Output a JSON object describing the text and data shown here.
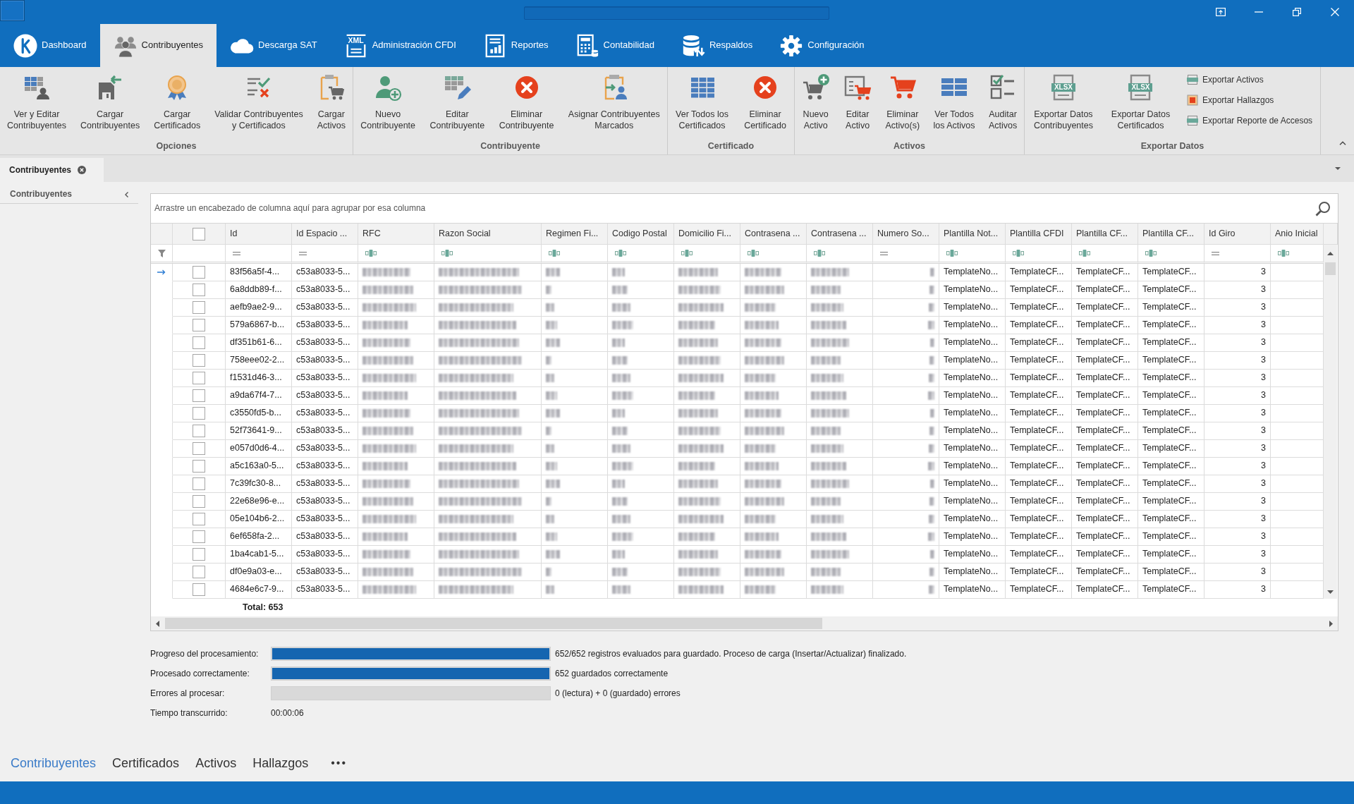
{
  "tabs": [
    {
      "label": "Dashboard",
      "selected": false
    },
    {
      "label": "Contribuyentes",
      "selected": true
    },
    {
      "label": "Descarga SAT",
      "selected": false
    },
    {
      "label": "Administración CFDI",
      "selected": false,
      "icon_text": "XML"
    },
    {
      "label": "Reportes",
      "selected": false
    },
    {
      "label": "Contabilidad",
      "selected": false
    },
    {
      "label": "Respaldos",
      "selected": false
    },
    {
      "label": "Configuración",
      "selected": false
    }
  ],
  "ribbon": {
    "groups": [
      {
        "title": "Opciones",
        "buttons": [
          {
            "label": "Ver y Editar\nContribuyentes"
          },
          {
            "label": "Cargar\nContribuyentes"
          },
          {
            "label": "Cargar\nCertificados"
          },
          {
            "label": "Validar Contribuyentes\ny Certificados"
          },
          {
            "label": "Cargar\nActivos"
          }
        ]
      },
      {
        "title": "Contribuyente",
        "buttons": [
          {
            "label": "Nuevo\nContribuyente"
          },
          {
            "label": "Editar\nContribuyente"
          },
          {
            "label": "Eliminar\nContribuyente"
          },
          {
            "label": "Asignar Contribuyentes\nMarcados"
          }
        ]
      },
      {
        "title": "Certificado",
        "buttons": [
          {
            "label": "Ver Todos los\nCertificados"
          },
          {
            "label": "Eliminar\nCertificado"
          }
        ]
      },
      {
        "title": "Activos",
        "buttons": [
          {
            "label": "Nuevo\nActivo"
          },
          {
            "label": "Editar\nActivo"
          },
          {
            "label": "Eliminar\nActivo(s)"
          },
          {
            "label": "Ver Todos\nlos Activos"
          },
          {
            "label": "Auditar\nActivos"
          }
        ]
      },
      {
        "title": "Exportar Datos",
        "buttons": [
          {
            "label": "Exportar Datos\nContribuyentes",
            "icon_text": "XLSX"
          },
          {
            "label": "Exportar Datos\nCertificados",
            "icon_text": "XLSX"
          }
        ],
        "small_buttons": [
          {
            "label": "Exportar Activos"
          },
          {
            "label": "Exportar Hallazgos"
          },
          {
            "label": "Exportar Reporte de Accesos"
          }
        ]
      }
    ]
  },
  "document_tabs": [
    {
      "label": "Contribuyentes",
      "selected": true
    }
  ],
  "side_panel": {
    "title": "Contribuyentes"
  },
  "grid": {
    "group_panel_hint": "Arrastre un encabezado de columna aquí para agrupar por esa columna",
    "select_all": {
      "checked": false
    },
    "columns": [
      {
        "header": "Id",
        "kind": "text",
        "filter": {
          "kind": "equals"
        }
      },
      {
        "header": "Id Espacio ...",
        "kind": "text",
        "filter": {
          "kind": "equals"
        }
      },
      {
        "header": "RFC",
        "kind": "masked",
        "filter": {
          "kind": "text"
        }
      },
      {
        "header": "Razon Social",
        "kind": "masked",
        "filter": {
          "kind": "text"
        }
      },
      {
        "header": "Regimen Fi...",
        "kind": "masked",
        "filter": {
          "kind": "text"
        }
      },
      {
        "header": "Codigo Postal",
        "kind": "masked",
        "filter": {
          "kind": "text"
        }
      },
      {
        "header": "Domicilio Fi...",
        "kind": "masked",
        "filter": {
          "kind": "text"
        }
      },
      {
        "header": "Contrasena ...",
        "kind": "masked",
        "filter": {
          "kind": "text"
        }
      },
      {
        "header": "Contrasena ...",
        "kind": "masked",
        "filter": {
          "kind": "text"
        }
      },
      {
        "header": "Numero So...",
        "kind": "maskednum",
        "filter": {
          "kind": "equals"
        }
      },
      {
        "header": "Plantilla Not...",
        "kind": "text",
        "filter": {
          "kind": "text"
        }
      },
      {
        "header": "Plantilla CFDI",
        "kind": "text",
        "filter": {
          "kind": "text"
        }
      },
      {
        "header": "Plantilla CF...",
        "kind": "text",
        "filter": {
          "kind": "text"
        }
      },
      {
        "header": "Plantilla CF...",
        "kind": "text",
        "filter": {
          "kind": "text"
        }
      },
      {
        "header": "Id Giro",
        "kind": "number",
        "filter": {
          "kind": "equals"
        }
      },
      {
        "header": "Anio Inicial",
        "kind": "blank",
        "filter": {
          "kind": "text"
        }
      }
    ],
    "rows": [
      {
        "selected": true,
        "checked": false,
        "cells": [
          "83f56a5f-4...",
          "c53a8033-5...",
          "TemplateNo...",
          "TemplateCF...",
          "TemplateCF...",
          "TemplateCF...",
          "3"
        ]
      },
      {
        "selected": false,
        "checked": false,
        "cells": [
          "6a8ddb89-f...",
          "c53a8033-5...",
          "TemplateNo...",
          "TemplateCF...",
          "TemplateCF...",
          "TemplateCF...",
          "3"
        ]
      },
      {
        "selected": false,
        "checked": false,
        "cells": [
          "aefb9ae2-9...",
          "c53a8033-5...",
          "TemplateNo...",
          "TemplateCF...",
          "TemplateCF...",
          "TemplateCF...",
          "3"
        ]
      },
      {
        "selected": false,
        "checked": false,
        "cells": [
          "579a6867-b...",
          "c53a8033-5...",
          "TemplateNo...",
          "TemplateCF...",
          "TemplateCF...",
          "TemplateCF...",
          "3"
        ]
      },
      {
        "selected": false,
        "checked": false,
        "cells": [
          "df351b61-6...",
          "c53a8033-5...",
          "TemplateNo...",
          "TemplateCF...",
          "TemplateCF...",
          "TemplateCF...",
          "3"
        ]
      },
      {
        "selected": false,
        "checked": false,
        "cells": [
          "758eee02-2...",
          "c53a8033-5...",
          "TemplateNo...",
          "TemplateCF...",
          "TemplateCF...",
          "TemplateCF...",
          "3"
        ]
      },
      {
        "selected": false,
        "checked": false,
        "cells": [
          "f1531d46-3...",
          "c53a8033-5...",
          "TemplateNo...",
          "TemplateCF...",
          "TemplateCF...",
          "TemplateCF...",
          "3"
        ]
      },
      {
        "selected": false,
        "checked": false,
        "cells": [
          "a9da67f4-7...",
          "c53a8033-5...",
          "TemplateNo...",
          "TemplateCF...",
          "TemplateCF...",
          "TemplateCF...",
          "3"
        ]
      },
      {
        "selected": false,
        "checked": false,
        "cells": [
          "c3550fd5-b...",
          "c53a8033-5...",
          "TemplateNo...",
          "TemplateCF...",
          "TemplateCF...",
          "TemplateCF...",
          "3"
        ]
      },
      {
        "selected": false,
        "checked": false,
        "cells": [
          "52f73641-9...",
          "c53a8033-5...",
          "TemplateNo...",
          "TemplateCF...",
          "TemplateCF...",
          "TemplateCF...",
          "3"
        ]
      },
      {
        "selected": false,
        "checked": false,
        "cells": [
          "e057d0d6-4...",
          "c53a8033-5...",
          "TemplateNo...",
          "TemplateCF...",
          "TemplateCF...",
          "TemplateCF...",
          "3"
        ]
      },
      {
        "selected": false,
        "checked": false,
        "cells": [
          "a5c163a0-5...",
          "c53a8033-5...",
          "TemplateNo...",
          "TemplateCF...",
          "TemplateCF...",
          "TemplateCF...",
          "3"
        ]
      },
      {
        "selected": false,
        "checked": false,
        "cells": [
          "7c39fc30-8...",
          "c53a8033-5...",
          "TemplateNo...",
          "TemplateCF...",
          "TemplateCF...",
          "TemplateCF...",
          "3"
        ]
      },
      {
        "selected": false,
        "checked": false,
        "cells": [
          "22e68e96-e...",
          "c53a8033-5...",
          "TemplateNo...",
          "TemplateCF...",
          "TemplateCF...",
          "TemplateCF...",
          "3"
        ]
      },
      {
        "selected": false,
        "checked": false,
        "cells": [
          "05e104b6-2...",
          "c53a8033-5...",
          "TemplateNo...",
          "TemplateCF...",
          "TemplateCF...",
          "TemplateCF...",
          "3"
        ]
      },
      {
        "selected": false,
        "checked": false,
        "cells": [
          "6ef658fa-2...",
          "c53a8033-5...",
          "TemplateNo...",
          "TemplateCF...",
          "TemplateCF...",
          "TemplateCF...",
          "3"
        ]
      },
      {
        "selected": false,
        "checked": false,
        "cells": [
          "1ba4cab1-5...",
          "c53a8033-5...",
          "TemplateNo...",
          "TemplateCF...",
          "TemplateCF...",
          "TemplateCF...",
          "3"
        ]
      },
      {
        "selected": false,
        "checked": false,
        "cells": [
          "df0e9a03-e...",
          "c53a8033-5...",
          "TemplateNo...",
          "TemplateCF...",
          "TemplateCF...",
          "TemplateCF...",
          "3"
        ]
      },
      {
        "selected": false,
        "checked": false,
        "cells": [
          "4684e6c7-9...",
          "c53a8033-5...",
          "TemplateNo...",
          "TemplateCF...",
          "TemplateCF...",
          "TemplateCF...",
          "3"
        ]
      }
    ],
    "total": "Total: 653"
  },
  "progress": [
    {
      "kind": "bar",
      "label": "Progreso del procesamiento:",
      "level": 1,
      "text": "652/652 registros evaluados para guardado. Proceso de carga (Insertar/Actualizar) finalizado."
    },
    {
      "kind": "bar",
      "label": "Procesado correctamente:",
      "level": 1,
      "text": "652 guardados correctamente"
    },
    {
      "kind": "bar",
      "label": "Errores al procesar:",
      "level": 0,
      "text": "0 (lectura) + 0 (guardado) errores"
    },
    {
      "kind": "time",
      "label": "Tiempo transcurrido:",
      "text": "00:00:06"
    }
  ],
  "bottom_nav": {
    "items": [
      {
        "label": "Contribuyentes",
        "selected": true
      },
      {
        "label": "Certificados",
        "selected": false
      },
      {
        "label": "Activos",
        "selected": false
      },
      {
        "label": "Hallazgos",
        "selected": false
      }
    ],
    "more": "•••"
  }
}
